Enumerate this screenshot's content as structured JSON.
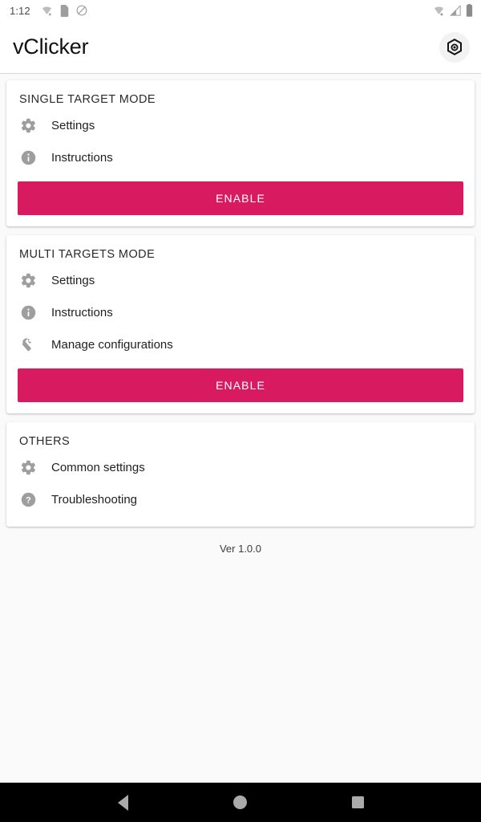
{
  "status_bar": {
    "time": "1:12",
    "icons_left": [
      "wifi-off-icon",
      "sim-card-icon",
      "do-not-disturb-icon"
    ],
    "icons_right": [
      "wifi-off-icon",
      "cellular-signal-icon",
      "battery-icon"
    ]
  },
  "toolbar": {
    "title": "vClicker",
    "action_icon": "target-hexagon-icon"
  },
  "cards": [
    {
      "title": "SINGLE TARGET MODE",
      "rows": [
        {
          "icon": "gear-icon",
          "label": "Settings"
        },
        {
          "icon": "info-circle-icon",
          "label": "Instructions"
        }
      ],
      "button": {
        "label": "ENABLE",
        "color": "#d81b60"
      }
    },
    {
      "title": "MULTI TARGETS MODE",
      "rows": [
        {
          "icon": "gear-icon",
          "label": "Settings"
        },
        {
          "icon": "info-circle-icon",
          "label": "Instructions"
        },
        {
          "icon": "wrench-icon",
          "label": "Manage configurations"
        }
      ],
      "button": {
        "label": "ENABLE",
        "color": "#d81b60"
      }
    },
    {
      "title": "OTHERS",
      "rows": [
        {
          "icon": "gear-icon",
          "label": "Common settings"
        },
        {
          "icon": "help-circle-icon",
          "label": "Troubleshooting"
        }
      ],
      "button": null
    }
  ],
  "version_text": "Ver 1.0.0",
  "nav_bar": {
    "back": "back-triangle-icon",
    "home": "home-circle-icon",
    "recents": "recents-square-icon"
  },
  "theme": {
    "accent": "#d81b60",
    "page_bg": "#fafafa",
    "card_bg": "#ffffff",
    "icon_gray": "#9e9e9e",
    "text_primary": "#1f1f1f"
  }
}
